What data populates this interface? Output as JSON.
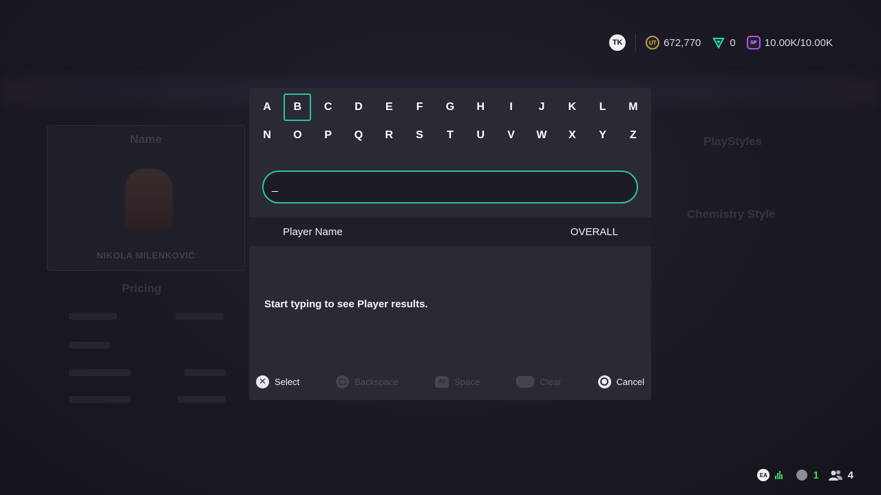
{
  "currency": {
    "coins": "672,770",
    "points": "0",
    "sp": "10.00K/10.00K"
  },
  "background": {
    "card_title": "Name",
    "player_name": "NIKOLA MILENKOVIĆ",
    "pricing_label": "Pricing",
    "playstyles_label": "PlayStyles",
    "chemistry_label": "Chemistry Style"
  },
  "keyboard": {
    "row1": [
      "A",
      "B",
      "C",
      "D",
      "E",
      "F",
      "G",
      "H",
      "I",
      "J",
      "K",
      "L",
      "M"
    ],
    "row2": [
      "N",
      "O",
      "P",
      "Q",
      "R",
      "S",
      "T",
      "U",
      "V",
      "W",
      "X",
      "Y",
      "Z"
    ],
    "selected": "B"
  },
  "search": {
    "value": "_"
  },
  "results": {
    "col_name": "Player Name",
    "col_overall": "OVERALL",
    "empty_message": "Start typing to see Player results."
  },
  "legend": {
    "select": "Select",
    "backspace": "Backspace",
    "space": "Space",
    "clear": "Clear",
    "cancel": "Cancel"
  },
  "status": {
    "rank": "1",
    "friends": "4"
  },
  "colors": {
    "accent": "#2ec0a0",
    "modal_bg": "#2a2a34",
    "page_bg": "#1a1923"
  }
}
